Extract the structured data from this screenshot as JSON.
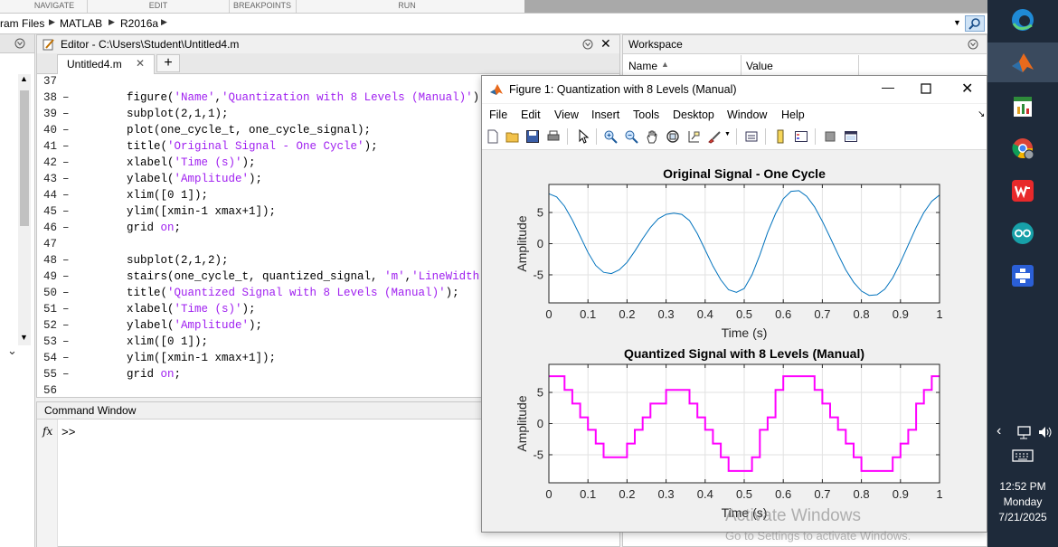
{
  "toolstrip": {
    "sections": [
      "NAVIGATE",
      "EDIT",
      "BREAKPOINTS",
      "RUN"
    ]
  },
  "address_bar": {
    "crumbs": [
      "ram Files",
      "MATLAB",
      "R2016a"
    ]
  },
  "editor": {
    "title": "Editor - C:\\Users\\Student\\Untitled4.m",
    "tab": "Untitled4.m",
    "lines": [
      {
        "n": "37",
        "dash": "",
        "parts": []
      },
      {
        "n": "38",
        "dash": "–",
        "parts": [
          {
            "t": "    figure(",
            "s": false
          },
          {
            "t": "'Name'",
            "s": true
          },
          {
            "t": ",",
            "s": false
          },
          {
            "t": "'Quantization with 8 Levels (Manual)'",
            "s": true
          },
          {
            "t": ");",
            "s": false
          }
        ]
      },
      {
        "n": "39",
        "dash": "–",
        "parts": [
          {
            "t": "    subplot(2,1,1);",
            "s": false
          }
        ]
      },
      {
        "n": "40",
        "dash": "–",
        "parts": [
          {
            "t": "    plot(one_cycle_t, one_cycle_signal);",
            "s": false
          }
        ]
      },
      {
        "n": "41",
        "dash": "–",
        "parts": [
          {
            "t": "    title(",
            "s": false
          },
          {
            "t": "'Original Signal - One Cycle'",
            "s": true
          },
          {
            "t": ");",
            "s": false
          }
        ]
      },
      {
        "n": "42",
        "dash": "–",
        "parts": [
          {
            "t": "    xlabel(",
            "s": false
          },
          {
            "t": "'Time (s)'",
            "s": true
          },
          {
            "t": ");",
            "s": false
          }
        ]
      },
      {
        "n": "43",
        "dash": "–",
        "parts": [
          {
            "t": "    ylabel(",
            "s": false
          },
          {
            "t": "'Amplitude'",
            "s": true
          },
          {
            "t": ");",
            "s": false
          }
        ]
      },
      {
        "n": "44",
        "dash": "–",
        "parts": [
          {
            "t": "    xlim([0 1]);",
            "s": false
          }
        ]
      },
      {
        "n": "45",
        "dash": "–",
        "parts": [
          {
            "t": "    ylim([xmin-1 xmax+1]);",
            "s": false
          }
        ]
      },
      {
        "n": "46",
        "dash": "–",
        "parts": [
          {
            "t": "    grid ",
            "s": false
          },
          {
            "t": "on",
            "s": true
          },
          {
            "t": ";",
            "s": false
          }
        ]
      },
      {
        "n": "47",
        "dash": "",
        "parts": []
      },
      {
        "n": "48",
        "dash": "–",
        "parts": [
          {
            "t": "    subplot(2,1,2);",
            "s": false
          }
        ]
      },
      {
        "n": "49",
        "dash": "–",
        "parts": [
          {
            "t": "    stairs(one_cycle_t, quantized_signal, ",
            "s": false
          },
          {
            "t": "'m'",
            "s": true
          },
          {
            "t": ",",
            "s": false
          },
          {
            "t": "'LineWidth'",
            "s": true
          }
        ]
      },
      {
        "n": "50",
        "dash": "–",
        "parts": [
          {
            "t": "    title(",
            "s": false
          },
          {
            "t": "'Quantized Signal with 8 Levels (Manual)'",
            "s": true
          },
          {
            "t": ");",
            "s": false
          }
        ]
      },
      {
        "n": "51",
        "dash": "–",
        "parts": [
          {
            "t": "    xlabel(",
            "s": false
          },
          {
            "t": "'Time (s)'",
            "s": true
          },
          {
            "t": ");",
            "s": false
          }
        ]
      },
      {
        "n": "52",
        "dash": "–",
        "parts": [
          {
            "t": "    ylabel(",
            "s": false
          },
          {
            "t": "'Amplitude'",
            "s": true
          },
          {
            "t": ");",
            "s": false
          }
        ]
      },
      {
        "n": "53",
        "dash": "–",
        "parts": [
          {
            "t": "    xlim([0 1]);",
            "s": false
          }
        ]
      },
      {
        "n": "54",
        "dash": "–",
        "parts": [
          {
            "t": "    ylim([xmin-1 xmax+1]);",
            "s": false
          }
        ]
      },
      {
        "n": "55",
        "dash": "–",
        "parts": [
          {
            "t": "    grid ",
            "s": false
          },
          {
            "t": "on",
            "s": true
          },
          {
            "t": ";",
            "s": false
          }
        ]
      },
      {
        "n": "56",
        "dash": "",
        "parts": []
      }
    ]
  },
  "command_window": {
    "title": "Command Window",
    "fx": "fx",
    "prompt": ">>"
  },
  "workspace": {
    "title": "Workspace",
    "col_name": "Name",
    "col_value": "Value"
  },
  "figure": {
    "title": "Figure 1: Quantization with 8 Levels (Manual)",
    "menu": [
      "File",
      "Edit",
      "View",
      "Insert",
      "Tools",
      "Desktop",
      "Window",
      "Help"
    ]
  },
  "taskbar": {
    "time": "12:52 PM",
    "day": "Monday",
    "date": "7/21/2025"
  },
  "watermark": {
    "line1": "Activate Windows",
    "line2": "Go to Settings to activate Windows."
  },
  "chart_data": [
    {
      "type": "line",
      "title": "Original Signal - One Cycle",
      "xlabel": "Time (s)",
      "ylabel": "Amplitude",
      "xlim": [
        0,
        1
      ],
      "ylim": [
        -9.5,
        9.5
      ],
      "xticks": [
        "0",
        "0.1",
        "0.2",
        "0.3",
        "0.4",
        "0.5",
        "0.6",
        "0.7",
        "0.8",
        "0.9",
        "1"
      ],
      "yticks": [
        "-5",
        "0",
        "5"
      ],
      "grid": true,
      "color": "#0072bd",
      "x": [
        0,
        0.02,
        0.04,
        0.06,
        0.08,
        0.1,
        0.12,
        0.14,
        0.16,
        0.18,
        0.2,
        0.22,
        0.24,
        0.26,
        0.28,
        0.3,
        0.32,
        0.34,
        0.36,
        0.38,
        0.4,
        0.42,
        0.44,
        0.46,
        0.48,
        0.5,
        0.52,
        0.54,
        0.56,
        0.58,
        0.6,
        0.62,
        0.64,
        0.66,
        0.68,
        0.7,
        0.72,
        0.74,
        0.76,
        0.78,
        0.8,
        0.82,
        0.84,
        0.86,
        0.88,
        0.9,
        0.92,
        0.94,
        0.96,
        0.98,
        1.0
      ],
      "y": [
        8.0,
        7.5,
        6.0,
        3.8,
        1.2,
        -1.4,
        -3.5,
        -4.6,
        -4.8,
        -4.2,
        -3.0,
        -1.2,
        0.8,
        2.6,
        4.0,
        4.7,
        4.9,
        4.7,
        3.7,
        1.6,
        -1.0,
        -3.6,
        -5.8,
        -7.4,
        -7.8,
        -7.2,
        -5.0,
        -1.8,
        1.8,
        4.8,
        7.2,
        8.4,
        8.5,
        7.6,
        5.9,
        3.6,
        1.0,
        -1.7,
        -4.2,
        -6.2,
        -7.6,
        -8.3,
        -8.2,
        -7.3,
        -5.5,
        -3.0,
        -0.2,
        2.6,
        5.0,
        6.8,
        7.8
      ]
    },
    {
      "type": "line",
      "title": "Quantized Signal with 8 Levels (Manual)",
      "xlabel": "Time (s)",
      "ylabel": "Amplitude",
      "xlim": [
        0,
        1
      ],
      "ylim": [
        -9.5,
        9.5
      ],
      "xticks": [
        "0",
        "0.1",
        "0.2",
        "0.3",
        "0.4",
        "0.5",
        "0.6",
        "0.7",
        "0.8",
        "0.9",
        "1"
      ],
      "yticks": [
        "-5",
        "0",
        "5"
      ],
      "grid": true,
      "color": "#ff00ff",
      "x": [
        0,
        0.02,
        0.04,
        0.06,
        0.08,
        0.1,
        0.12,
        0.14,
        0.16,
        0.18,
        0.2,
        0.22,
        0.24,
        0.26,
        0.28,
        0.3,
        0.32,
        0.34,
        0.36,
        0.38,
        0.4,
        0.42,
        0.44,
        0.46,
        0.48,
        0.5,
        0.52,
        0.54,
        0.56,
        0.58,
        0.6,
        0.62,
        0.64,
        0.66,
        0.68,
        0.7,
        0.72,
        0.74,
        0.76,
        0.78,
        0.8,
        0.82,
        0.84,
        0.86,
        0.88,
        0.9,
        0.92,
        0.94,
        0.96,
        0.98,
        1.0
      ],
      "y": [
        7.6,
        7.6,
        5.4,
        3.2,
        1.0,
        -1.0,
        -3.2,
        -5.4,
        -5.4,
        -5.4,
        -3.2,
        -1.0,
        1.0,
        3.2,
        3.2,
        5.4,
        5.4,
        5.4,
        3.2,
        1.0,
        -1.0,
        -3.2,
        -5.4,
        -7.6,
        -7.6,
        -7.6,
        -5.4,
        -1.0,
        1.0,
        5.4,
        7.6,
        7.6,
        7.6,
        7.6,
        5.4,
        3.2,
        1.0,
        -1.0,
        -3.2,
        -5.4,
        -7.6,
        -7.6,
        -7.6,
        -7.6,
        -5.4,
        -3.2,
        -1.0,
        3.2,
        5.4,
        7.6,
        7.6
      ]
    }
  ]
}
